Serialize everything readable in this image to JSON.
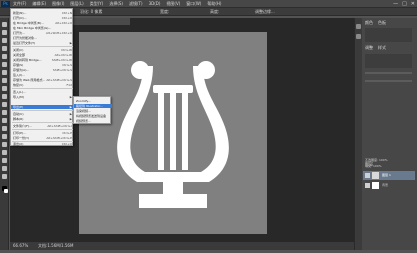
{
  "menubar": {
    "logo": "Ps",
    "items": [
      "文件(F)",
      "编辑(E)",
      "图像(I)",
      "图层(L)",
      "类型(Y)",
      "选择(S)",
      "滤镜(T)",
      "3D(D)",
      "视图(V)",
      "窗口(W)",
      "帮助(H)"
    ],
    "window_controls": [
      "—",
      "□",
      "✕"
    ]
  },
  "options_bar": {
    "feather": "羽化: 0 像素",
    "width_label": "宽度:",
    "height_label": "高度:",
    "refine_edge": "调整边缘..."
  },
  "file_menu": {
    "items": [
      {
        "label": "新建(N)...",
        "shortcut": "Ctrl+N"
      },
      {
        "label": "打开(O)...",
        "shortcut": "Ctrl+O"
      },
      {
        "label": "在 Bridge 中浏览(B)...",
        "shortcut": "Alt+Ctrl+O"
      },
      {
        "label": "在 Mini Bridge 中浏览(G)...",
        "shortcut": ""
      },
      {
        "label": "打开为...",
        "shortcut": "Alt+Shift+Ctrl+O"
      },
      {
        "label": "打开为智能对象...",
        "shortcut": ""
      },
      {
        "label": "最近打开文件(T)",
        "shortcut": "▶"
      },
      {
        "label": "关闭(C)",
        "shortcut": "Ctrl+W"
      },
      {
        "label": "关闭全部",
        "shortcut": "Alt+Ctrl+W"
      },
      {
        "label": "关闭并转到 Bridge...",
        "shortcut": "Shift+Ctrl+W"
      },
      {
        "label": "存储(S)",
        "shortcut": "Ctrl+S"
      },
      {
        "label": "存储为(A)...",
        "shortcut": "Shift+Ctrl+S"
      },
      {
        "label": "签入(I)...",
        "shortcut": ""
      },
      {
        "label": "存储为 Web 所用格式...",
        "shortcut": "Alt+Shift+Ctrl+S"
      },
      {
        "label": "恢复(V)",
        "shortcut": "F12"
      },
      {
        "label": "置入(L)...",
        "shortcut": ""
      },
      {
        "label": "导入(M)",
        "shortcut": "▶"
      },
      {
        "label": "导出(E)",
        "shortcut": "▶"
      },
      {
        "label": "自动(U)",
        "shortcut": "▶"
      },
      {
        "label": "脚本(R)",
        "shortcut": "▶"
      },
      {
        "label": "文件简介(F)...",
        "shortcut": "Alt+Shift+Ctrl+I"
      },
      {
        "label": "打印(P)...",
        "shortcut": "Ctrl+P"
      },
      {
        "label": "打印一份(Y)",
        "shortcut": "Alt+Shift+Ctrl+P"
      },
      {
        "label": "退出(X)",
        "shortcut": "Ctrl+Q"
      }
    ],
    "highlighted": "导出(E)"
  },
  "export_submenu": {
    "items": [
      "Zoomify...",
      "路径到 Illustrator...",
      "渲染视频...",
      "将视频预览发送到设备",
      "视频预览..."
    ],
    "highlighted": "路径到 Illustrator..."
  },
  "status_bar": {
    "zoom": "66.67%",
    "doc_info": "文档:1.56M/1.56M"
  },
  "right_panel": {
    "tabs": [
      "颜色",
      "色板"
    ],
    "adjust_tab": "调整",
    "styles_tab": "样式",
    "layers_tab": "图层",
    "opacity": "不透明度: 100%",
    "fill": "填充: 100%",
    "layer_names": [
      "图层 1",
      "背景"
    ]
  },
  "colors": {
    "canvas_bg": "#808080",
    "icon_fill": "#ffffff",
    "menu_highlight": "#3a7bd5",
    "workspace": "#282828"
  }
}
